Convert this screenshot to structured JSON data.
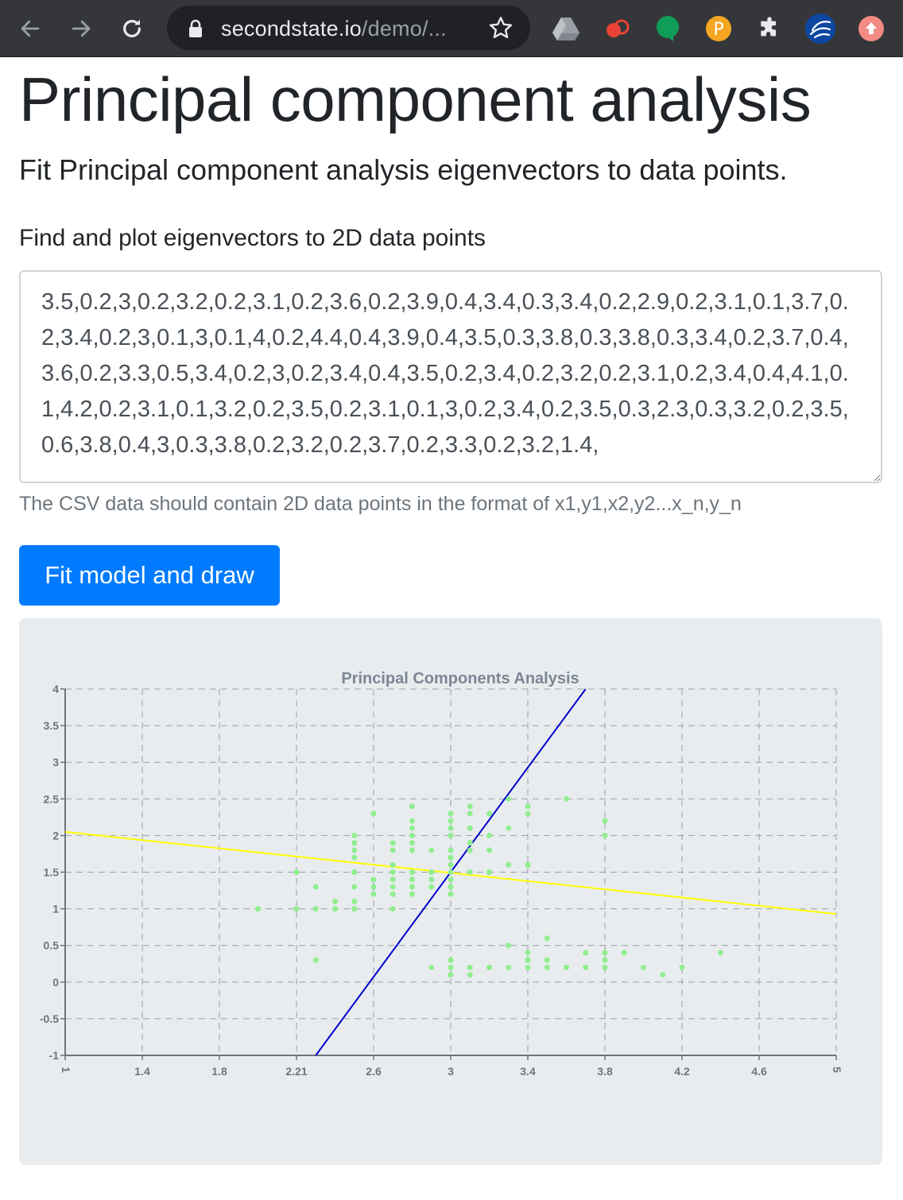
{
  "browser": {
    "url_host": "secondstate.io",
    "url_path": "/demo/..."
  },
  "page": {
    "title": "Principal component analysis",
    "lead": "Fit Principal component analysis eigenvectors to data points.",
    "form_label": "Find and plot eigenvectors to 2D data points",
    "csv_value": "3.5,0.2,3,0.2,3.2,0.2,3.1,0.2,3.6,0.2,3.9,0.4,3.4,0.3,3.4,0.2,2.9,0.2,3.1,0.1,3.7,0.2,3.4,0.2,3,0.1,3,0.1,4,0.2,4.4,0.4,3.9,0.4,3.5,0.3,3.8,0.3,3.8,0.3,3.4,0.2,3.7,0.4,3.6,0.2,3.3,0.5,3.4,0.2,3,0.2,3.4,0.4,3.5,0.2,3.4,0.2,3.2,0.2,3.1,0.2,3.4,0.4,4.1,0.1,4.2,0.2,3.1,0.1,3.2,0.2,3.5,0.2,3.1,0.1,3,0.2,3.4,0.2,3.5,0.3,2.3,0.3,3.2,0.2,3.5,0.6,3.8,0.4,3,0.3,3.8,0.2,3.2,0.2,3.7,0.2,3.3,0.2,3.2,1.4,",
    "help_text": "The CSV data should contain 2D data points in the format of x1,y1,x2,y2...x_n,y_n",
    "fit_button": "Fit model and draw"
  },
  "chart_data": {
    "type": "scatter",
    "title": "Principal Components Analysis",
    "xlim": [
      1,
      5
    ],
    "ylim": [
      -1,
      4
    ],
    "x_ticks": [
      "1",
      "1.4",
      "1.8",
      "2.21",
      "2.6",
      "3",
      "3.4",
      "3.8",
      "4.2",
      "4.6",
      "5"
    ],
    "x_tick_values": [
      1,
      1.4,
      1.8,
      2.2,
      2.6,
      3,
      3.4,
      3.8,
      4.2,
      4.6,
      5
    ],
    "y_ticks": [
      "4",
      "3.5",
      "3",
      "2.5",
      "2",
      "1.5",
      "1",
      "0.5",
      "0",
      "-0.5",
      "-1"
    ],
    "y_tick_values": [
      4,
      3.5,
      3,
      2.5,
      2,
      1.5,
      1,
      0.5,
      0,
      -0.5,
      -1
    ],
    "grid": true,
    "point_color": "#90ee90",
    "lines": [
      {
        "color": "#ffff00",
        "x": [
          1,
          5
        ],
        "y": [
          2.05,
          0.93
        ]
      },
      {
        "color": "#0000cc",
        "x": [
          2.3,
          3.7
        ],
        "y": [
          -1,
          4
        ]
      }
    ],
    "points": [
      [
        3.5,
        0.2
      ],
      [
        3,
        0.2
      ],
      [
        3.2,
        0.2
      ],
      [
        3.1,
        0.2
      ],
      [
        3.6,
        0.2
      ],
      [
        3.9,
        0.4
      ],
      [
        3.4,
        0.3
      ],
      [
        3.4,
        0.2
      ],
      [
        2.9,
        0.2
      ],
      [
        3.1,
        0.1
      ],
      [
        3.7,
        0.2
      ],
      [
        3,
        0.1
      ],
      [
        4,
        0.2
      ],
      [
        4.4,
        0.4
      ],
      [
        3.5,
        0.3
      ],
      [
        3.8,
        0.3
      ],
      [
        3.7,
        0.4
      ],
      [
        3.3,
        0.5
      ],
      [
        3.4,
        0.4
      ],
      [
        4.1,
        0.1
      ],
      [
        4.2,
        0.2
      ],
      [
        2.3,
        0.3
      ],
      [
        3.5,
        0.6
      ],
      [
        3.8,
        0.4
      ],
      [
        3,
        0.3
      ],
      [
        3.8,
        0.2
      ],
      [
        3.3,
        0.2
      ],
      [
        2,
        1
      ],
      [
        2.2,
        1
      ],
      [
        2.3,
        1
      ],
      [
        2.4,
        1
      ],
      [
        2.4,
        1.1
      ],
      [
        2.5,
        1.1
      ],
      [
        2.5,
        1
      ],
      [
        2.7,
        1
      ],
      [
        2.6,
        1.2
      ],
      [
        2.7,
        1.2
      ],
      [
        2.8,
        1.2
      ],
      [
        2.2,
        1.5
      ],
      [
        2.3,
        1.3
      ],
      [
        2.5,
        1.3
      ],
      [
        2.6,
        1.3
      ],
      [
        2.7,
        1.3
      ],
      [
        2.8,
        1.3
      ],
      [
        2.9,
        1.3
      ],
      [
        3,
        1.2
      ],
      [
        3,
        1.3
      ],
      [
        2.6,
        1.4
      ],
      [
        2.7,
        1.4
      ],
      [
        2.8,
        1.4
      ],
      [
        2.9,
        1.4
      ],
      [
        3,
        1.4
      ],
      [
        2.5,
        1.5
      ],
      [
        2.7,
        1.5
      ],
      [
        2.8,
        1.5
      ],
      [
        2.9,
        1.5
      ],
      [
        3,
        1.5
      ],
      [
        3.1,
        1.5
      ],
      [
        3.2,
        1.5
      ],
      [
        2.7,
        1.6
      ],
      [
        3,
        1.6
      ],
      [
        3.3,
        1.6
      ],
      [
        3.4,
        1.6
      ],
      [
        2.5,
        1.7
      ],
      [
        3,
        1.7
      ],
      [
        2.5,
        1.8
      ],
      [
        2.7,
        1.8
      ],
      [
        2.8,
        1.8
      ],
      [
        2.9,
        1.8
      ],
      [
        3,
        1.8
      ],
      [
        3.1,
        1.8
      ],
      [
        3.2,
        1.8
      ],
      [
        2.5,
        1.9
      ],
      [
        2.7,
        1.9
      ],
      [
        2.8,
        1.9
      ],
      [
        2.5,
        2
      ],
      [
        2.8,
        2
      ],
      [
        3,
        2
      ],
      [
        3.2,
        2
      ],
      [
        3.8,
        2
      ],
      [
        2.8,
        2.1
      ],
      [
        3,
        2.1
      ],
      [
        3.1,
        2.1
      ],
      [
        2.8,
        2.2
      ],
      [
        3,
        2.2
      ],
      [
        3.8,
        2.2
      ],
      [
        2.6,
        2.3
      ],
      [
        3,
        2.3
      ],
      [
        3.1,
        2.3
      ],
      [
        3.2,
        2.3
      ],
      [
        3.4,
        2.3
      ],
      [
        2.8,
        2.4
      ],
      [
        3.1,
        2.4
      ],
      [
        3.4,
        2.4
      ],
      [
        3.3,
        2.5
      ],
      [
        3.6,
        2.5
      ],
      [
        3.3,
        2.1
      ],
      [
        3.1,
        1.9
      ]
    ]
  }
}
